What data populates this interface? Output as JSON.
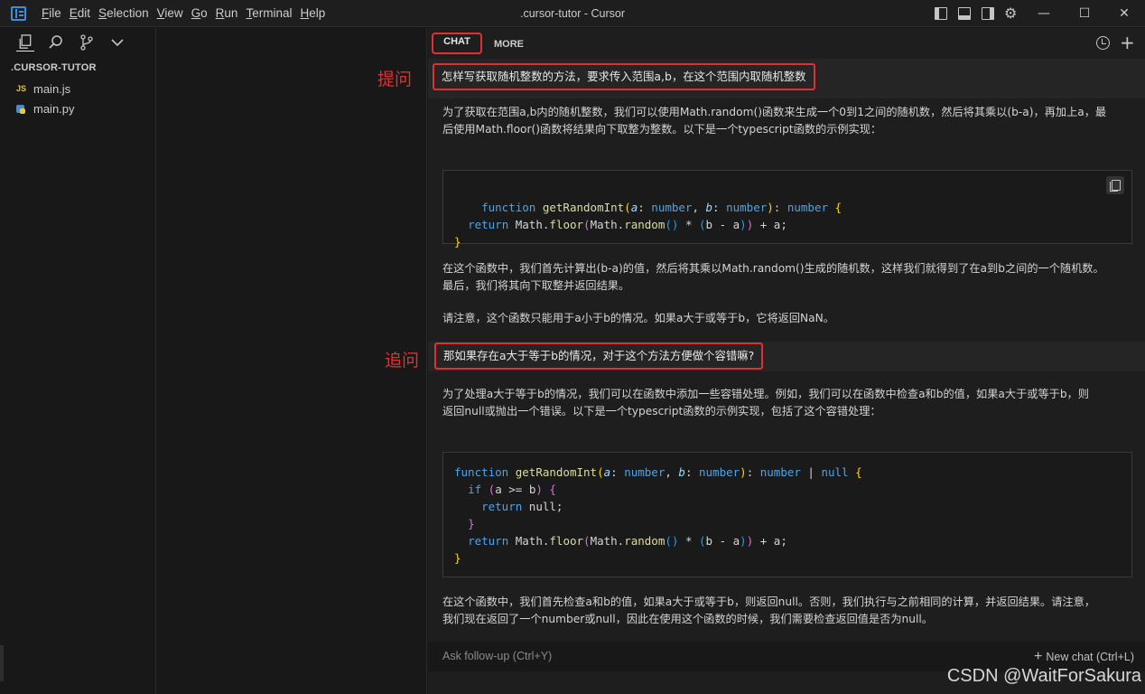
{
  "window": {
    "title": ".cursor-tutor - Cursor",
    "menu": [
      "File",
      "Edit",
      "Selection",
      "View",
      "Go",
      "Run",
      "Terminal",
      "Help"
    ],
    "controls": {
      "minimize": "—",
      "maximize": "☐",
      "close": "✕"
    }
  },
  "sidebar": {
    "icons": [
      "explorer-icon",
      "search-icon",
      "source-control-icon",
      "chevron-down-icon"
    ],
    "header": ".CURSOR-TUTOR",
    "files": [
      {
        "badge": "JS",
        "name": "main.js"
      },
      {
        "badge": "py",
        "name": "main.py"
      }
    ]
  },
  "annotations": {
    "question": "提问",
    "followup": "追问"
  },
  "chat": {
    "tabs": [
      "CHAT",
      "MORE"
    ],
    "q1": "怎样写获取随机整数的方法，要求传入范围a,b，在这个范围内取随机整数",
    "a1_intro_1": "为了获取在范围a,b内的随机整数，我们可以使用Math.random()函数来生成一个0到1之间的随机数，然后将其乘以(b-a)，再加上a，最",
    "a1_intro_2": "后使用Math.floor()函数将结果向下取整为整数。以下是一个typescript函数的示例实现：",
    "a1_after_1": "在这个函数中，我们首先计算出(b-a)的值，然后将其乘以Math.random()生成的随机数，这样我们就得到了在a到b之间的一个随机数。",
    "a1_after_2": "最后，我们将其向下取整并返回结果。",
    "a1_note": "请注意，这个函数只能用于a小于b的情况。如果a大于或等于b，它将返回NaN。",
    "q2": "那如果存在a大于等于b的情况，对于这个方法方便做个容错嘛?",
    "a2_intro_1": "为了处理a大于等于b的情况，我们可以在函数中添加一些容错处理。例如，我们可以在函数中检查a和b的值，如果a大于或等于b，则",
    "a2_intro_2": "返回null或抛出一个错误。以下是一个typescript函数的示例实现，包括了这个容错处理：",
    "a2_after_1": "在这个函数中，我们首先检查a和b的值，如果a大于或等于b，则返回null。否则，我们执行与之前相同的计算，并返回结果。请注意，",
    "a2_after_2": "我们现在返回了一个number或null，因此在使用这个函数的时候，我们需要检查返回值是否为null。",
    "followup_placeholder": "Ask follow-up (Ctrl+Y)",
    "new_chat": "New chat (Ctrl+L)"
  },
  "code1": {
    "kw_function": "function",
    "fn_name": "getRandomInt",
    "param_a": "a",
    "param_b": "b",
    "type_number": "number",
    "kw_return": "return",
    "body_1": "Math.",
    "body_floor": "floor",
    "body_2": "Math.",
    "body_random": "random",
    "body_3": " * ",
    "body_4": "b - a",
    "body_5": " + a;"
  },
  "code2": {
    "kw_null": "null",
    "kw_if": "if",
    "cond": "a >= b",
    "return_null": "null;"
  },
  "watermark": "CSDN @WaitForSakura"
}
